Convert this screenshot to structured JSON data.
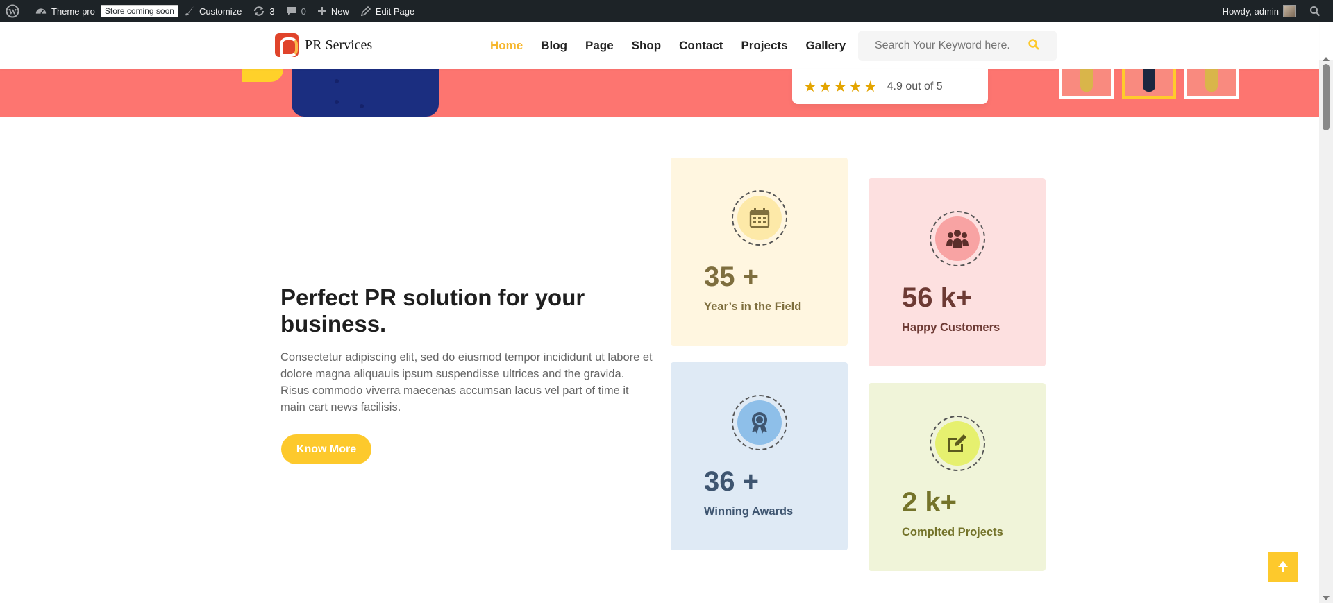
{
  "adminbar": {
    "site_name": "Theme pro",
    "store_badge": "Store coming soon",
    "customize": "Customize",
    "updates_count": "3",
    "comments_count": "0",
    "new": "New",
    "edit_page": "Edit Page",
    "howdy": "Howdy, admin"
  },
  "header": {
    "logo_text": "PR Services",
    "nav": [
      "Home",
      "Blog",
      "Page",
      "Shop",
      "Contact",
      "Projects",
      "Gallery"
    ],
    "active_nav": "Home",
    "search_placeholder": "Search Your Keyword here."
  },
  "banner": {
    "rating_text": "4.9 out of 5",
    "stars": "★★★★★"
  },
  "hero": {
    "title": "Perfect PR solution for your business.",
    "text": "Consectetur adipiscing elit, sed do eiusmod tempor incididunt ut labore et dolore magna aliquauis ipsum suspendisse ultrices and the gravida. Risus commodo viverra maecenas accumsan lacus vel part of time it main cart news facilisis.",
    "button": "Know More"
  },
  "stats": [
    {
      "number": "35 +",
      "label": "Year’s in the Field",
      "icon": "calendar-icon",
      "bg": "#fff6e0",
      "icon_bg": "#fde9a8",
      "color": "#7e6e3e"
    },
    {
      "number": "56 k+",
      "label": "Happy Customers",
      "icon": "group-icon",
      "bg": "#fde0e0",
      "icon_bg": "#f8a3a3",
      "color": "#6d3a34"
    },
    {
      "number": "36 +",
      "label": "Winning Awards",
      "icon": "award-icon",
      "bg": "#dfeaf5",
      "icon_bg": "#8ebfe9",
      "color": "#3e5570"
    },
    {
      "number": "2 k+",
      "label": "Complted Projects",
      "icon": "edit-icon",
      "bg": "#f0f4d9",
      "icon_bg": "#e6f06f",
      "color": "#74732a"
    }
  ],
  "colors": {
    "accent": "#fdc92c",
    "banner": "#fd7570",
    "adminbar": "#1d2327"
  }
}
